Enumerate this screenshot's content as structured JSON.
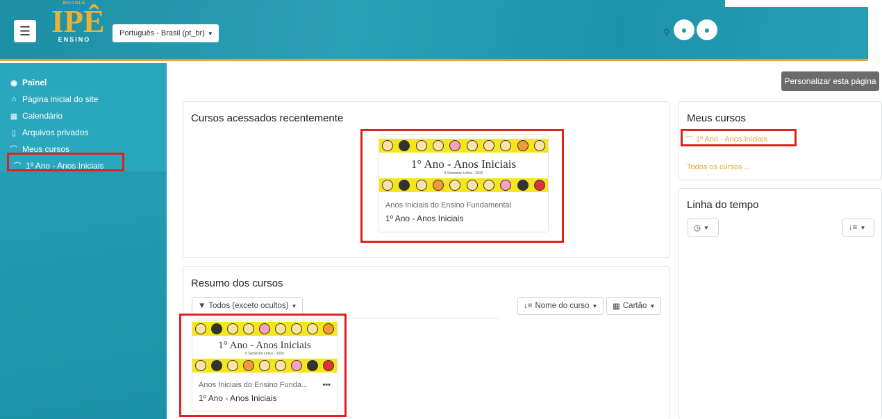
{
  "navbar": {
    "logo_top": "MOODLE",
    "logo_main": "IPÊ",
    "logo_sub": "ENSINO",
    "language": "Português - Brasil (pt_br)"
  },
  "sidebar": {
    "items": [
      {
        "label": "Painel",
        "icon": "dashboard-icon"
      },
      {
        "label": "Página inicial do site",
        "icon": "home-icon"
      },
      {
        "label": "Calendário",
        "icon": "calendar-icon"
      },
      {
        "label": "Arquivos privados",
        "icon": "file-icon"
      },
      {
        "label": "Meus cursos",
        "icon": "graduation-cap-icon"
      },
      {
        "label": "1º Ano - Anos Iniciais",
        "icon": "graduation-cap-icon"
      }
    ]
  },
  "main": {
    "customize_label": "Personalizar esta página",
    "recent": {
      "title": "Cursos acessados recentemente",
      "course_img_title": "1° Ano - Anos Iniciais",
      "course_img_sub": "II Semestre Letivo - 2020",
      "category": "Anos Iniciais do Ensino Fundamental",
      "name": "1º Ano - Anos Iniciais"
    },
    "overview": {
      "title": "Resumo dos cursos",
      "filter_label": "Todos (exceto ocultos)",
      "sort_label": "Nome do curso",
      "view_label": "Cartão",
      "course_img_title": "1° Ano - Anos Iniciais",
      "course_img_sub": "II Semestre Letivo - 2020",
      "category": "Anos Iniciais do Ensino Funda...",
      "name": "1º Ano - Anos Iniciais"
    }
  },
  "right": {
    "my_courses": {
      "title": "Meus cursos",
      "course_link": "1º Ano - Anos Iniciais",
      "all_courses": "Todos os cursos ..."
    },
    "timeline": {
      "title": "Linha do tempo"
    }
  },
  "colors": {
    "brand_teal": "#1e9bb2",
    "accent_gold": "#e8b13a",
    "highlight_red": "#e0211f"
  }
}
